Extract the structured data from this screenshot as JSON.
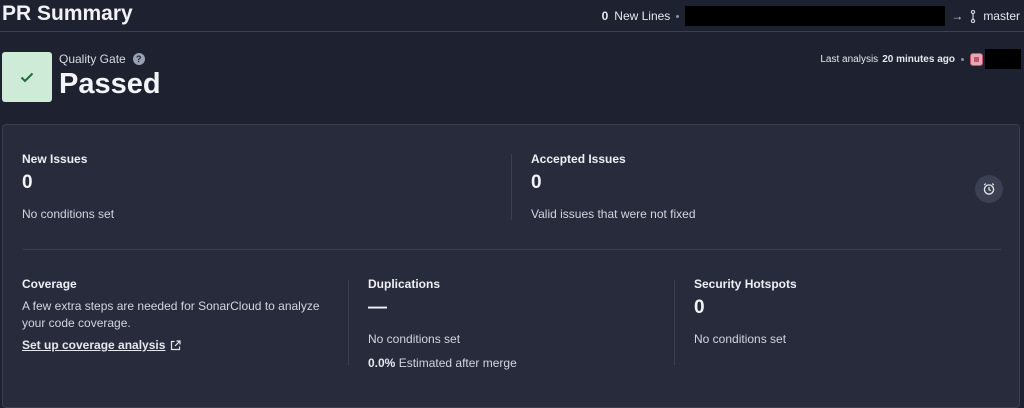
{
  "header": {
    "title": "PR Summary",
    "new_lines_count": "0",
    "new_lines_label": "New Lines",
    "target_branch": "master"
  },
  "quality_gate": {
    "label": "Quality Gate",
    "status": "Passed",
    "help_symbol": "?"
  },
  "analysis": {
    "label": "Last analysis",
    "time": "20 minutes ago"
  },
  "metrics": {
    "new_issues": {
      "title": "New Issues",
      "value": "0",
      "desc": "No conditions set"
    },
    "accepted_issues": {
      "title": "Accepted Issues",
      "value": "0",
      "desc": "Valid issues that were not fixed"
    },
    "coverage": {
      "title": "Coverage",
      "desc": "A few extra steps are needed for SonarCloud to analyze your code coverage.",
      "link": "Set up coverage analysis"
    },
    "duplications": {
      "title": "Duplications",
      "value": "—",
      "desc": "No conditions set",
      "merge_value": "0.0%",
      "merge_label": "Estimated after merge"
    },
    "security_hotspots": {
      "title": "Security Hotspots",
      "value": "0",
      "desc": "No conditions set"
    }
  },
  "colors": {
    "background": "#1d2130",
    "panel": "#272b3b",
    "gate_passed": "#cdebd6",
    "check": "#1f6b3a"
  },
  "icons": [
    "help-icon",
    "arrow-right-icon",
    "branch-icon",
    "check-icon",
    "clock-icon",
    "external-link-icon",
    "avatar"
  ]
}
